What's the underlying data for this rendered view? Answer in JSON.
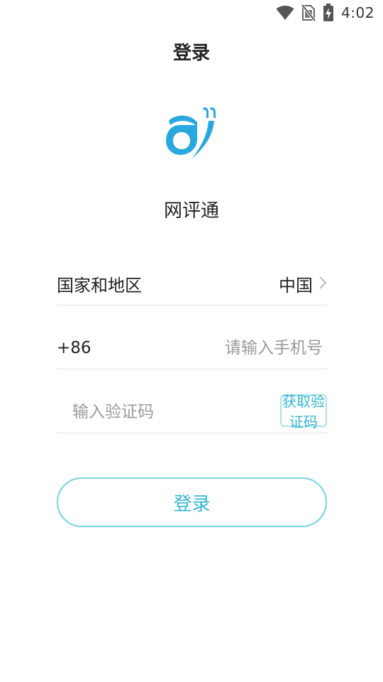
{
  "status_bar": {
    "time": "4:02",
    "icons": [
      "wifi-icon",
      "no-sim-icon",
      "battery-charging-icon"
    ]
  },
  "header": {
    "title": "登录"
  },
  "logo": {
    "icon": "app-logo-icon",
    "accent_color": "#29a8e0"
  },
  "app": {
    "name": "网评通"
  },
  "form": {
    "region": {
      "label": "国家和地区",
      "value": "中国",
      "icon": "chevron-right-icon"
    },
    "phone": {
      "prefix": "+86",
      "value": "",
      "placeholder": "请输入手机号"
    },
    "code": {
      "value": "",
      "placeholder": "输入验证码",
      "get_code_label": "获取验证码"
    }
  },
  "actions": {
    "login_label": "登录",
    "accent_color": "#33b6d0"
  }
}
